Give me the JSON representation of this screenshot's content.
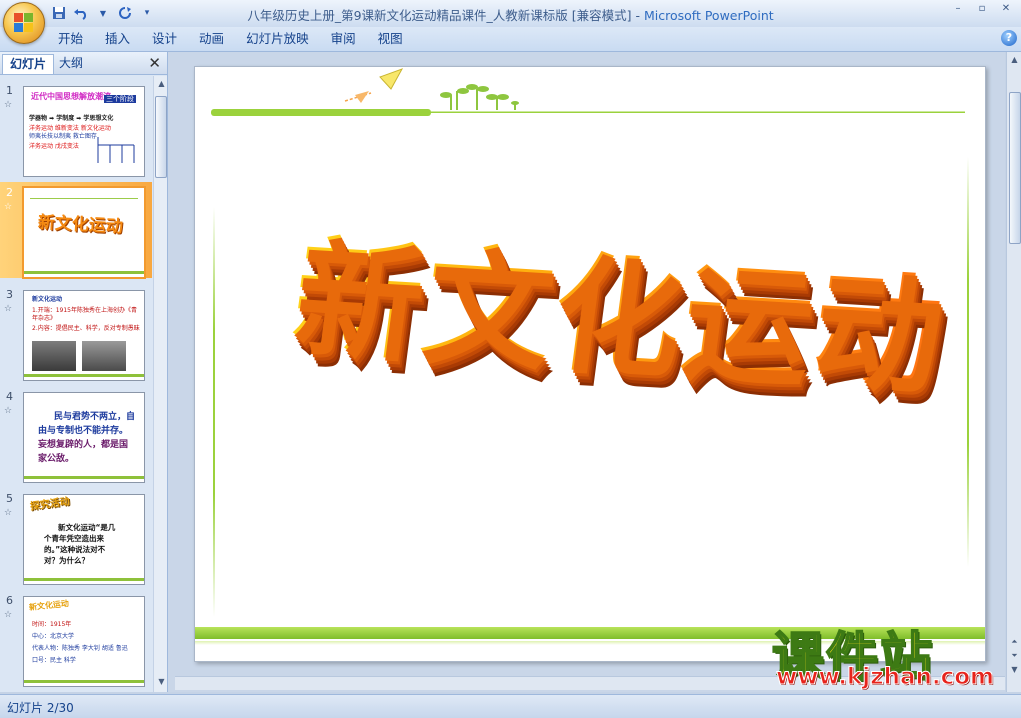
{
  "window": {
    "title": "八年级历史上册_第9课新文化运动精品课件_人教新课标版 [兼容模式]",
    "separator": " - ",
    "app_name": "Microsoft PowerPoint",
    "controls": [
      "–",
      "▫",
      "✕"
    ]
  },
  "quick_access": [
    "save-icon",
    "undo-icon",
    "redo-icon",
    "customize-icon"
  ],
  "ribbon": {
    "tabs": [
      "开始",
      "插入",
      "设计",
      "动画",
      "幻灯片放映",
      "审阅",
      "视图"
    ],
    "help": "?"
  },
  "left_pane": {
    "tabs": {
      "slides": "幻灯片",
      "outline": "大纲"
    },
    "close": "✕",
    "thumbnails": [
      {
        "num": "1",
        "star": "☆",
        "title": "近代中国思想解放潮流",
        "badge": "三个阶段",
        "lines": [
          "学器物 ➡ 学制度 ➡ 学思想文化",
          "洋务运动   维新变法   新文化运动",
          "师夷长技以制夷  救亡图存",
          "洋务运动   戊戌变法"
        ]
      },
      {
        "num": "2",
        "star": "☆",
        "title": "新文化运动"
      },
      {
        "num": "3",
        "star": "☆",
        "title": "新文化运动",
        "lines": [
          "1.开端：1915年陈独秀在上海创办《青年杂志》",
          "2.内容：提倡民主、科学，反对专制愚昧"
        ]
      },
      {
        "num": "4",
        "star": "☆",
        "lines": [
          "民与君势不两立，自",
          "由与专制也不能并存。",
          "妄想复辟的人，都是国",
          "家公敌。"
        ]
      },
      {
        "num": "5",
        "star": "☆",
        "title": "探究活动",
        "lines": [
          "新文化运动“是几",
          "个青年凭空造出来",
          "的。”这种说法对不",
          "对？为什么？"
        ]
      },
      {
        "num": "6",
        "star": "☆",
        "title": "新文化运动",
        "lines": [
          "时间：1915年",
          "中心：北京大学",
          "代表人物：陈独秀 李大钊 胡适 鲁迅",
          "口号：民主 科学"
        ]
      }
    ]
  },
  "slide": {
    "title": "新文化运动"
  },
  "status": {
    "slide_indicator": "幻灯片 2/30"
  },
  "watermark": {
    "cn": "课件站",
    "url": "www.kjzhan.com"
  }
}
